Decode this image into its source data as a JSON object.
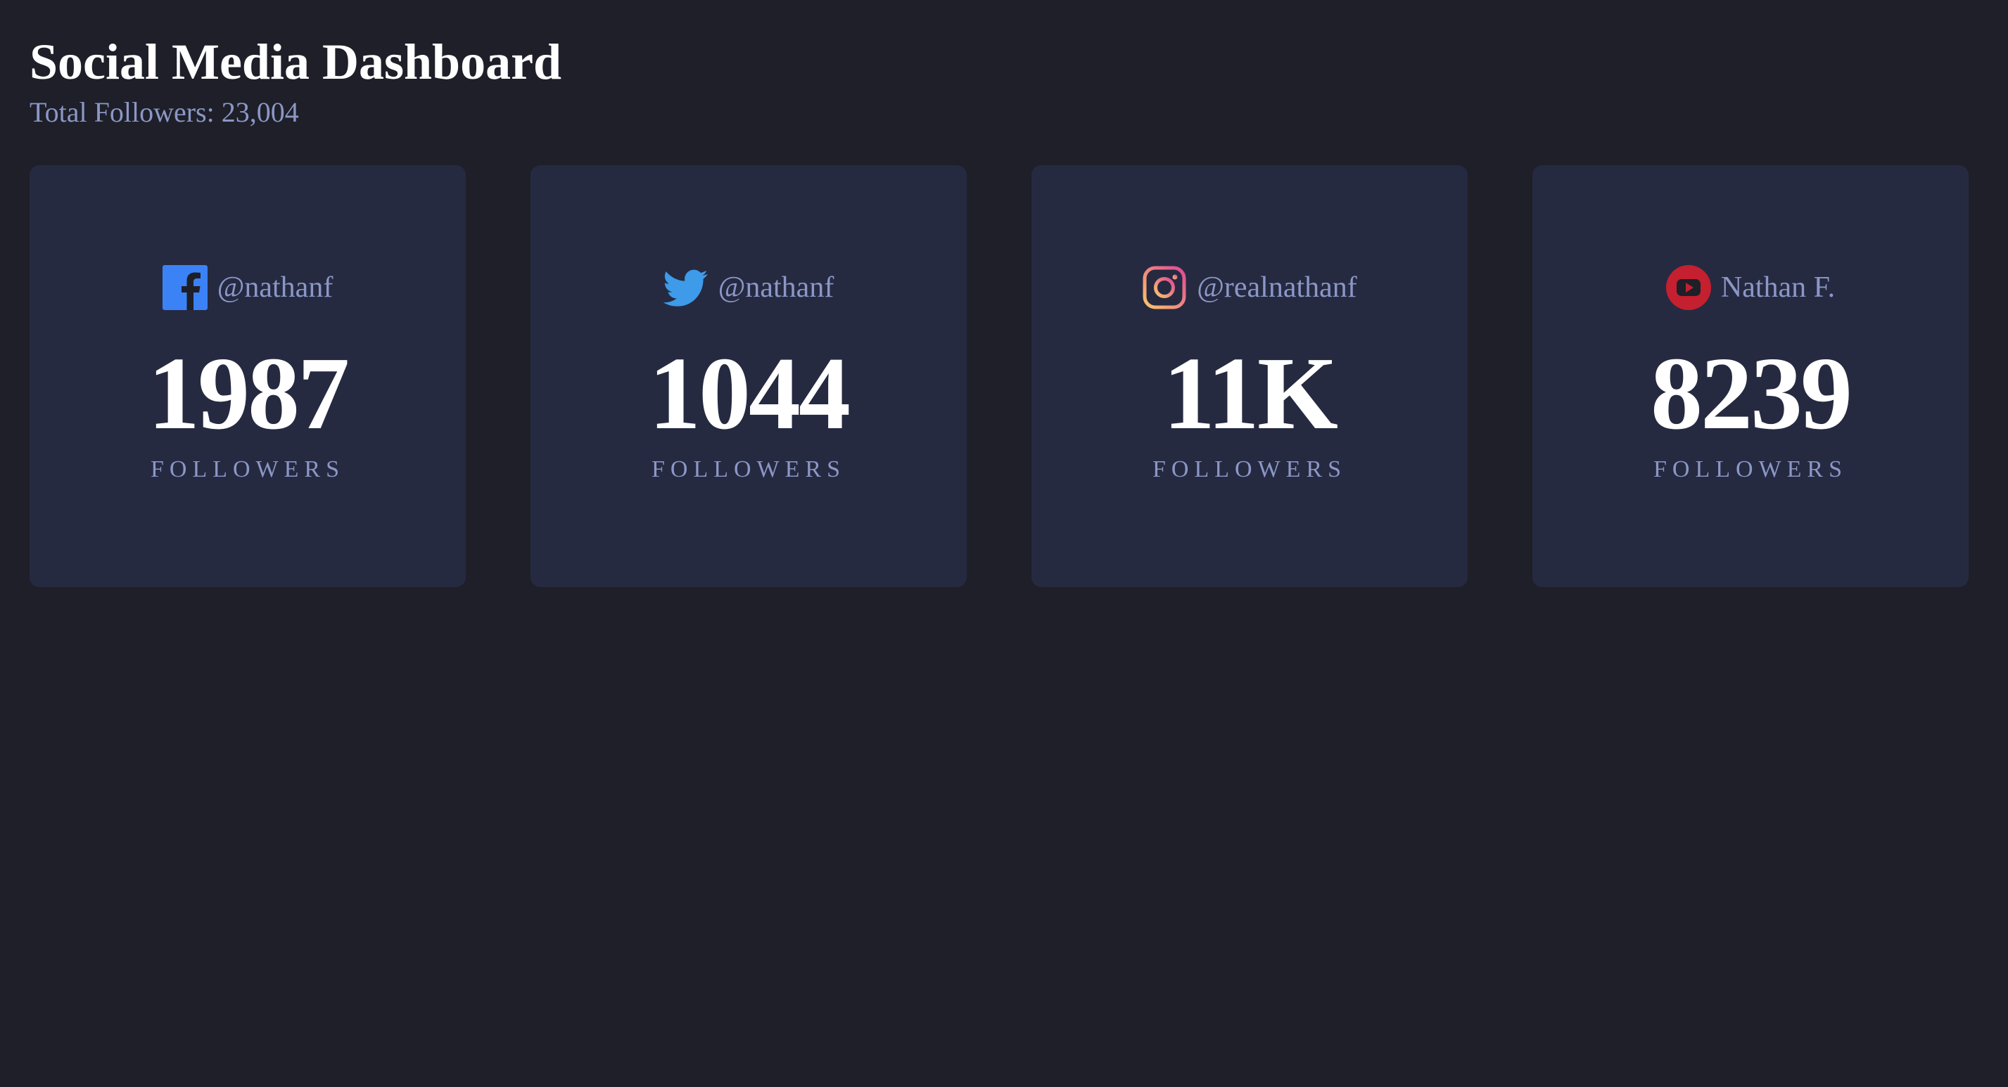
{
  "header": {
    "title": "Social Media Dashboard",
    "total_followers": "Total Followers: 23,004"
  },
  "colors": {
    "background": "#1e1f28",
    "card": "#252a41",
    "muted_text": "#8b97c6",
    "facebook": "#3b82f6",
    "twitter": "#3d9be9",
    "youtube": "#c4202f"
  },
  "cards": [
    {
      "platform": "facebook",
      "icon": "facebook-icon",
      "handle": "@nathanf",
      "count": "1987",
      "label": "FOLLOWERS"
    },
    {
      "platform": "twitter",
      "icon": "twitter-icon",
      "handle": "@nathanf",
      "count": "1044",
      "label": "FOLLOWERS"
    },
    {
      "platform": "instagram",
      "icon": "instagram-icon",
      "handle": "@realnathanf",
      "count": "11K",
      "label": "FOLLOWERS"
    },
    {
      "platform": "youtube",
      "icon": "youtube-icon",
      "handle": "Nathan F.",
      "count": "8239",
      "label": "FOLLOWERS"
    }
  ]
}
